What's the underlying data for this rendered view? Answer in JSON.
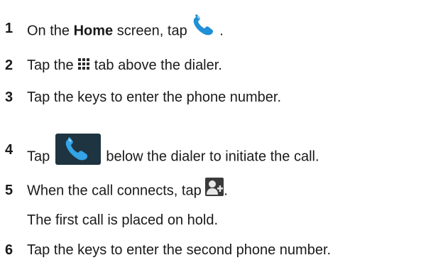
{
  "steps": [
    {
      "number": "1",
      "before": "On the ",
      "bold": "Home",
      "after": " screen, tap ",
      "icon": "phone-handset-icon",
      "end": "."
    },
    {
      "number": "2",
      "before": "Tap the ",
      "icon": "dialpad-grid-icon",
      "after": " tab above the dialer."
    },
    {
      "number": "3",
      "text": "Tap the keys to enter the phone number."
    },
    {
      "number": "4",
      "before": "Tap ",
      "icon": "call-button-icon",
      "after": " below the dialer to initiate the call."
    },
    {
      "number": "5",
      "before": "When the call connects, tap ",
      "icon": "add-call-icon",
      "end": "."
    },
    {
      "note": "The first call is placed on hold."
    },
    {
      "number": "6",
      "text": "Tap the keys to enter the second phone number."
    }
  ],
  "colors": {
    "text": "#1a1a1a",
    "phone_icon_blue": "#1f8fd6",
    "call_button_bg": "#1e3440",
    "dialpad_icon": "#2a2a2a"
  }
}
